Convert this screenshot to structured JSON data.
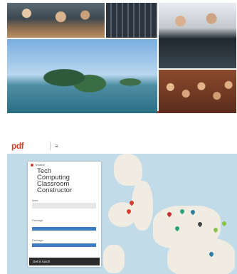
{
  "collage": {
    "photos": [
      {
        "name": "workers-carrying-boxes"
      },
      {
        "name": "server-room"
      },
      {
        "name": "computer-lab"
      },
      {
        "name": "mangrove-island"
      },
      {
        "name": "students-crowd"
      }
    ]
  },
  "map_app": {
    "logo": "pdf",
    "logo_sub": "",
    "menu_icon": "≡",
    "panel": {
      "header": "Tentative",
      "title_lines": [
        "Tech",
        "Computing",
        "Classroom",
        "Constructor"
      ],
      "field_label": "Area",
      "section_label": "Package",
      "section_sub": "",
      "button1": "",
      "section2_label": "Package",
      "button2": "",
      "footer_button": "Get in touch"
    },
    "colors": {
      "water": "#c2dbe9",
      "land": "#f1ece2",
      "accent": "#d6402c",
      "button": "#3d7dc2"
    }
  }
}
